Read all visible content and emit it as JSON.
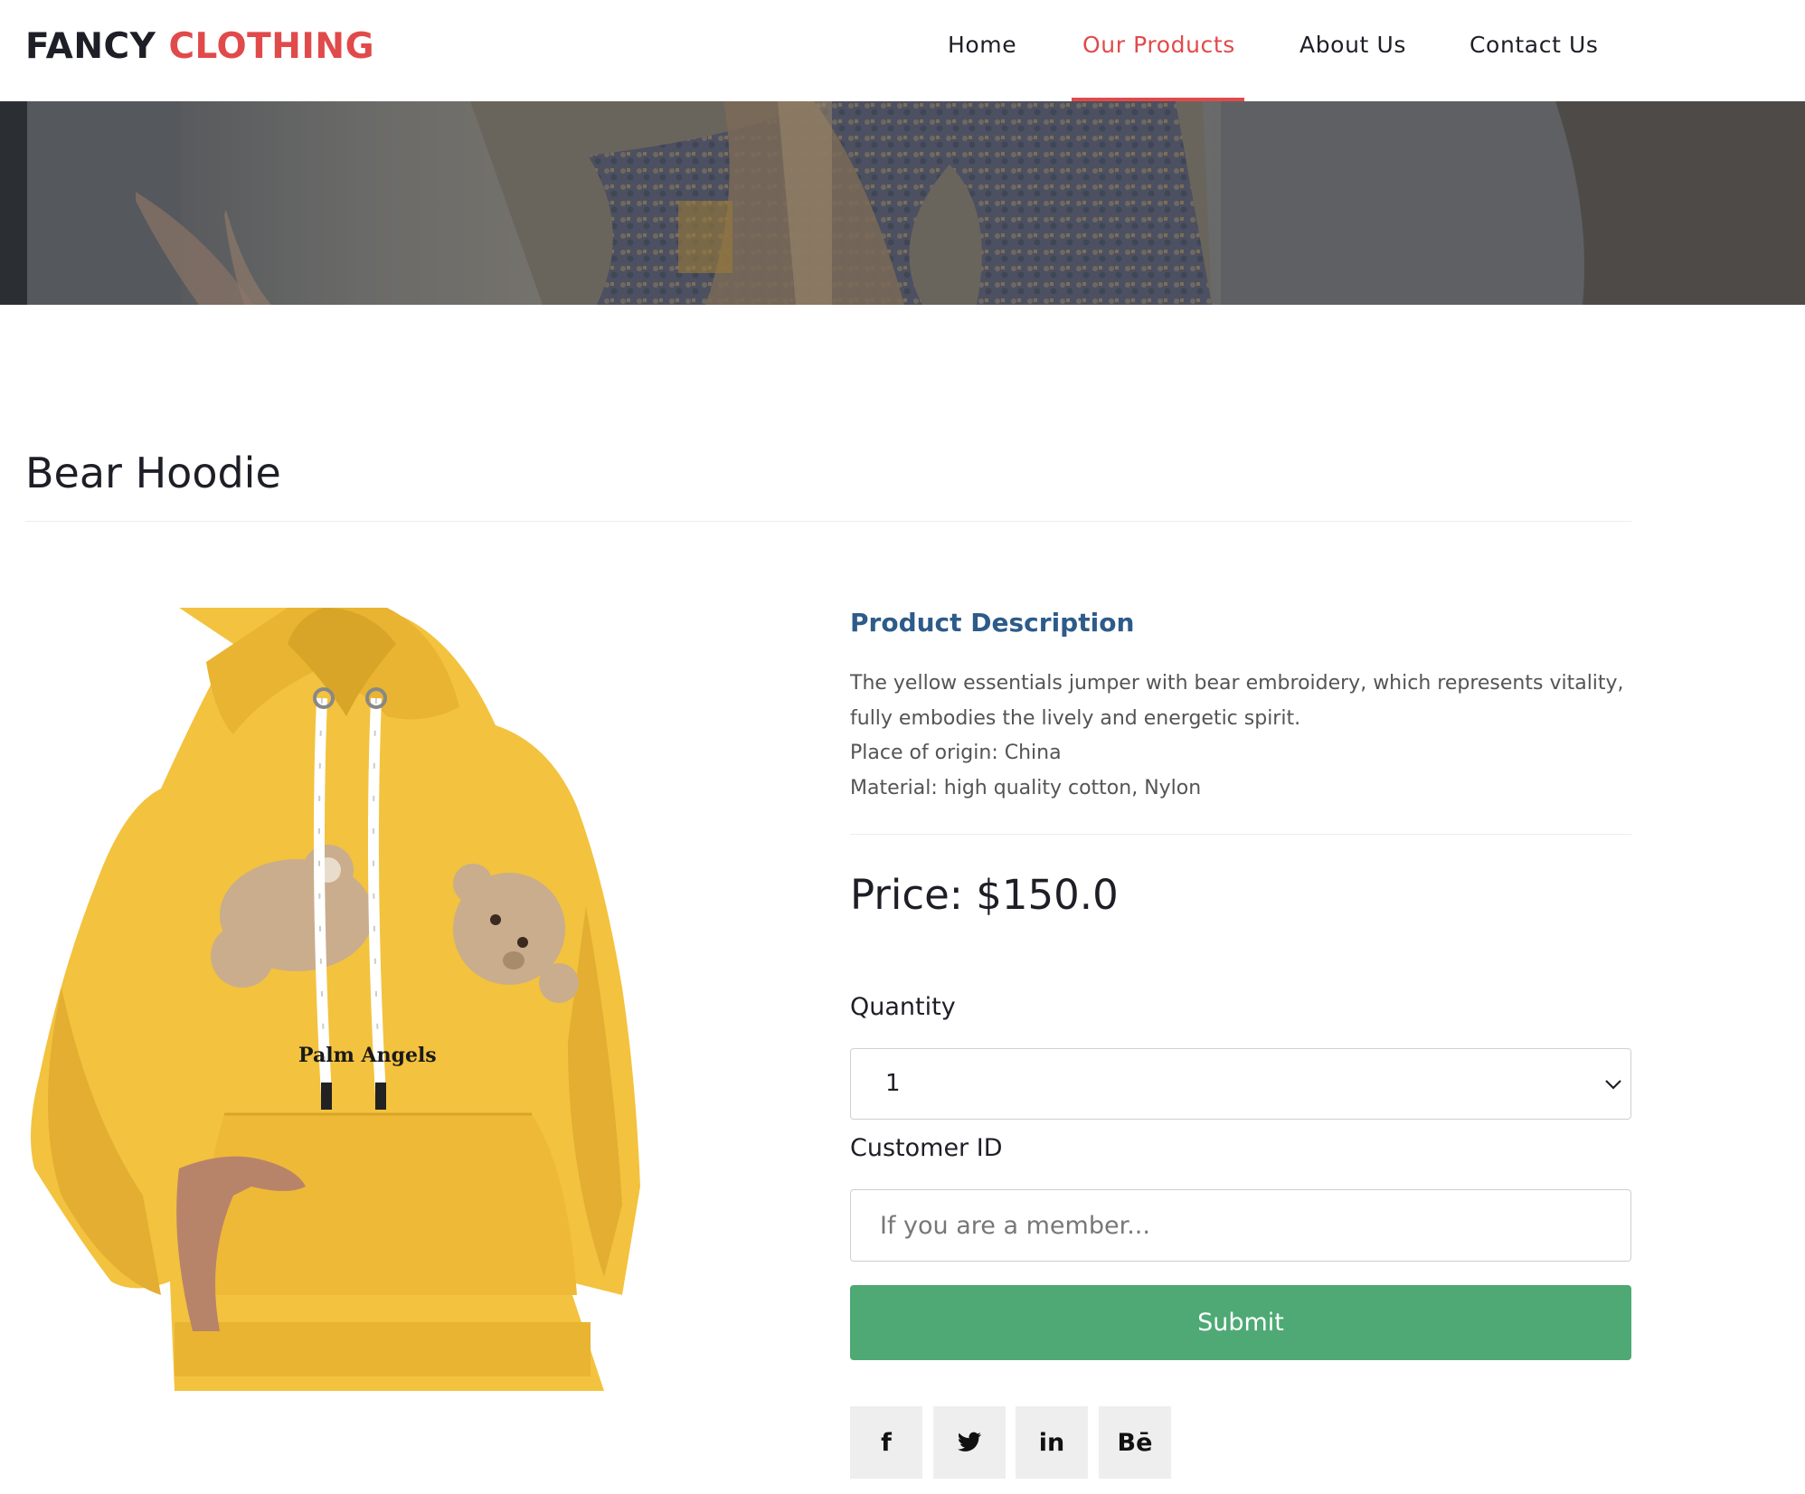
{
  "header": {
    "logo_part1": "FANCY",
    "logo_part2": "CLOTHING",
    "nav": [
      {
        "label": "Home",
        "active": false
      },
      {
        "label": "Our Products",
        "active": true
      },
      {
        "label": "About Us",
        "active": false
      },
      {
        "label": "Contact Us",
        "active": false
      }
    ]
  },
  "product": {
    "title": "Bear Hoodie",
    "description_heading": "Product Description",
    "description_lines": [
      "The yellow essentials jumper with bear embroidery, which represents vitality,",
      "fully embodies the lively and energetic spirit.",
      "Place of origin: China",
      "Material: high quality cotton, Nylon"
    ],
    "price_label": "Price: $150.0",
    "image_print_text": "Palm Angels"
  },
  "form": {
    "quantity_label": "Quantity",
    "quantity_value": "1",
    "customer_id_label": "Customer ID",
    "customer_id_placeholder": "If you are a member...",
    "submit_label": "Submit"
  },
  "social": [
    {
      "icon": "facebook-icon",
      "glyph": "f"
    },
    {
      "icon": "twitter-icon",
      "glyph": "🐦"
    },
    {
      "icon": "linkedin-icon",
      "glyph": "in"
    },
    {
      "icon": "behance-icon",
      "glyph": "Bē"
    }
  ],
  "colors": {
    "accent": "#e14a4a",
    "heading_blue": "#2d5b8a",
    "submit_green": "#4ea974",
    "hoodie_yellow": "#f3c23e"
  }
}
